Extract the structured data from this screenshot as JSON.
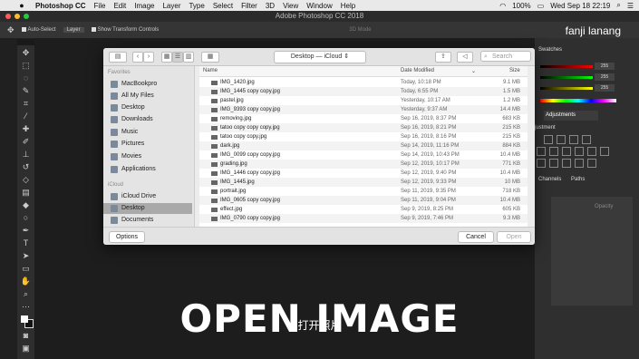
{
  "menubar": {
    "app": "Photoshop CC",
    "items": [
      "File",
      "Edit",
      "Image",
      "Layer",
      "Type",
      "Select",
      "Filter",
      "3D",
      "View",
      "Window",
      "Help"
    ],
    "battery": "100%",
    "clock": "Wed Sep 18  22:19"
  },
  "window_title": "Adobe Photoshop CC 2018",
  "options": {
    "auto_select": "Auto-Select",
    "layer": "Layer",
    "transform": "Show Transform Controls",
    "mode3d": "3D Mode"
  },
  "user_name": "fanji lanang",
  "panels": {
    "swatches": "Swatches",
    "adjustments": "Adjustments",
    "adjustment_label": "justment",
    "channels": "Channels",
    "paths": "Paths",
    "opacity": "Opacity",
    "val1": "255",
    "val2": "255",
    "val3": "255"
  },
  "dialog": {
    "location": "Desktop — iCloud",
    "search_placeholder": "Search",
    "sidebar": {
      "favorites_title": "Favorites",
      "favorites": [
        "MacBookpro",
        "All My Files",
        "Desktop",
        "Downloads",
        "Music",
        "Pictures",
        "Movies",
        "Applications"
      ],
      "icloud_title": "iCloud",
      "icloud": [
        "iCloud Drive",
        "Desktop",
        "Documents"
      ]
    },
    "columns": {
      "name": "Name",
      "date": "Date Modified",
      "size": "Size"
    },
    "files": [
      {
        "name": "IMG_1420.jpg",
        "date": "Today, 10:18 PM",
        "size": "9.1 MB"
      },
      {
        "name": "IMG_1445 copy copy.jpg",
        "date": "Today, 6:55 PM",
        "size": "1.5 MB"
      },
      {
        "name": "pastel.jpg",
        "date": "Yesterday, 10:17 AM",
        "size": "1.2 MB"
      },
      {
        "name": "IMG_9393 copy copy.jpg",
        "date": "Yesterday, 9:37 AM",
        "size": "14.4 MB"
      },
      {
        "name": "removing.jpg",
        "date": "Sep 16, 2019, 8:37 PM",
        "size": "683 KB"
      },
      {
        "name": "tatoo copy copy copy.jpg",
        "date": "Sep 16, 2019, 8:21 PM",
        "size": "215 KB"
      },
      {
        "name": "tatoo copy copy.jpg",
        "date": "Sep 16, 2019, 8:16 PM",
        "size": "215 KB"
      },
      {
        "name": "dark.jpg",
        "date": "Sep 14, 2019, 11:16 PM",
        "size": "884 KB"
      },
      {
        "name": "IMG_0099 copy copy.jpg",
        "date": "Sep 14, 2019, 10:43 PM",
        "size": "10.4 MB"
      },
      {
        "name": "grading.jpg",
        "date": "Sep 12, 2019, 10:17 PM",
        "size": "771 KB"
      },
      {
        "name": "IMG_1446 copy copy.jpg",
        "date": "Sep 12, 2019, 9:40 PM",
        "size": "10.4 MB"
      },
      {
        "name": "IMG_1445.jpg",
        "date": "Sep 12, 2019, 9:33 PM",
        "size": "10 MB"
      },
      {
        "name": "portrait.jpg",
        "date": "Sep 11, 2019, 9:35 PM",
        "size": "718 KB"
      },
      {
        "name": "IMG_0605 copy copy.jpg",
        "date": "Sep 11, 2019, 9:04 PM",
        "size": "10.4 MB"
      },
      {
        "name": "effect.jpg",
        "date": "Sep 9, 2019, 8:25 PM",
        "size": "605 KB"
      },
      {
        "name": "IMG_0790 copy copy.jpg",
        "date": "Sep 9, 2019, 7:46 PM",
        "size": "9.3 MB"
      }
    ],
    "buttons": {
      "options": "Options",
      "cancel": "Cancel",
      "open": "Open"
    }
  },
  "caption": "OPEN IMAGE",
  "subcaption": "打开照片",
  "colors": {
    "dialog_bg": "#ececec",
    "selected_sidebar": "#a9a9a9",
    "ps_dark": "#2f2f2f"
  }
}
